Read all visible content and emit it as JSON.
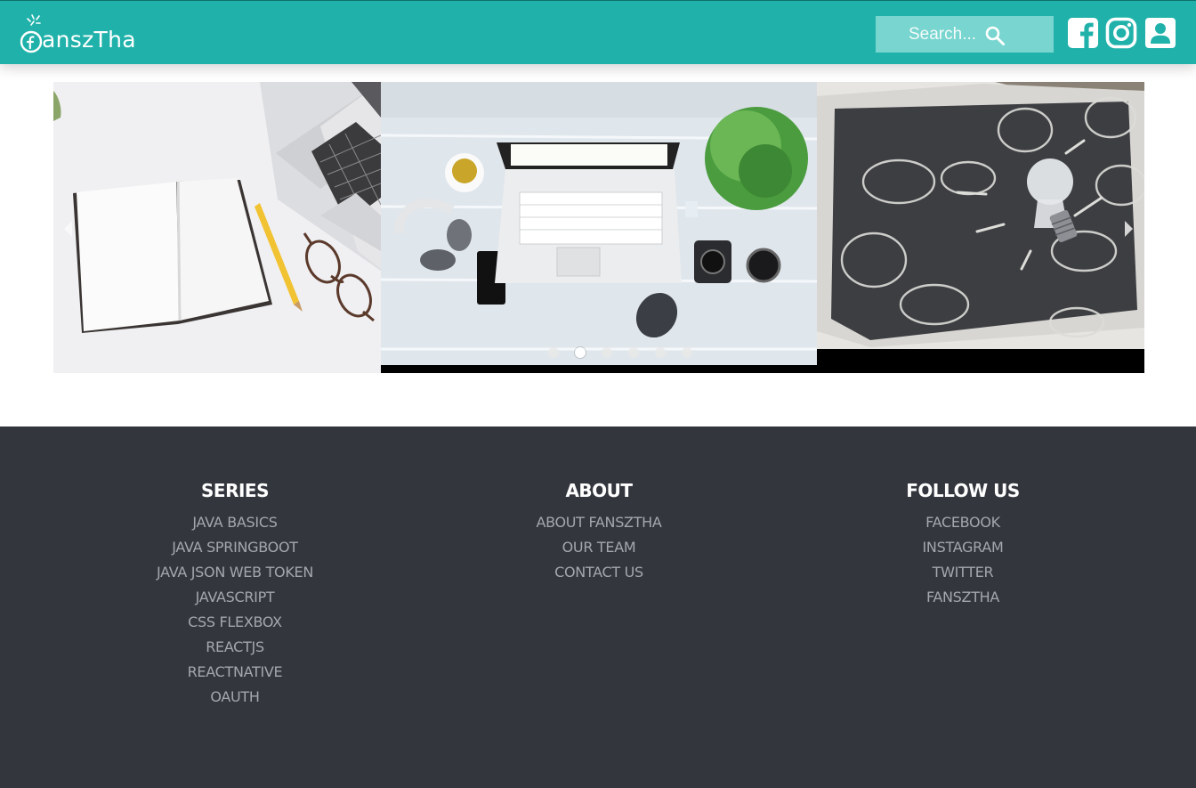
{
  "brand": {
    "name": "anszTha",
    "logo_letter": "f"
  },
  "search": {
    "placeholder": "Search..."
  },
  "header_icons": [
    "facebook-square-icon",
    "instagram-icon",
    "user-account-icon"
  ],
  "colors": {
    "header": "#20b2aa",
    "search_bg": "#78d5cf",
    "footer": "#33363d",
    "footer_heading": "#ffffff",
    "footer_link": "#a4a7ad"
  },
  "carousel": {
    "slides": [
      "notebook-pencil-glasses-laptop",
      "laptop-headphones-camera-desk",
      "lightbulb-chalkboard"
    ],
    "dot_count": 6,
    "active_dot": 2
  },
  "footer": {
    "series": {
      "heading": "SERIES",
      "links": [
        "JAVA BASICS",
        "JAVA SPRINGBOOT",
        "JAVA JSON WEB TOKEN",
        "JAVASCRIPT",
        "CSS FLEXBOX",
        "REACTJS",
        "REACTNATIVE",
        "OAUTH"
      ]
    },
    "about": {
      "heading": "ABOUT",
      "links": [
        "ABOUT FANSZTHA",
        "OUR TEAM",
        "CONTACT US"
      ]
    },
    "follow": {
      "heading": "FOLLOW US",
      "links": [
        "FACEBOOK",
        "INSTAGRAM",
        "TWITTER",
        "FANSZTHA"
      ]
    }
  }
}
